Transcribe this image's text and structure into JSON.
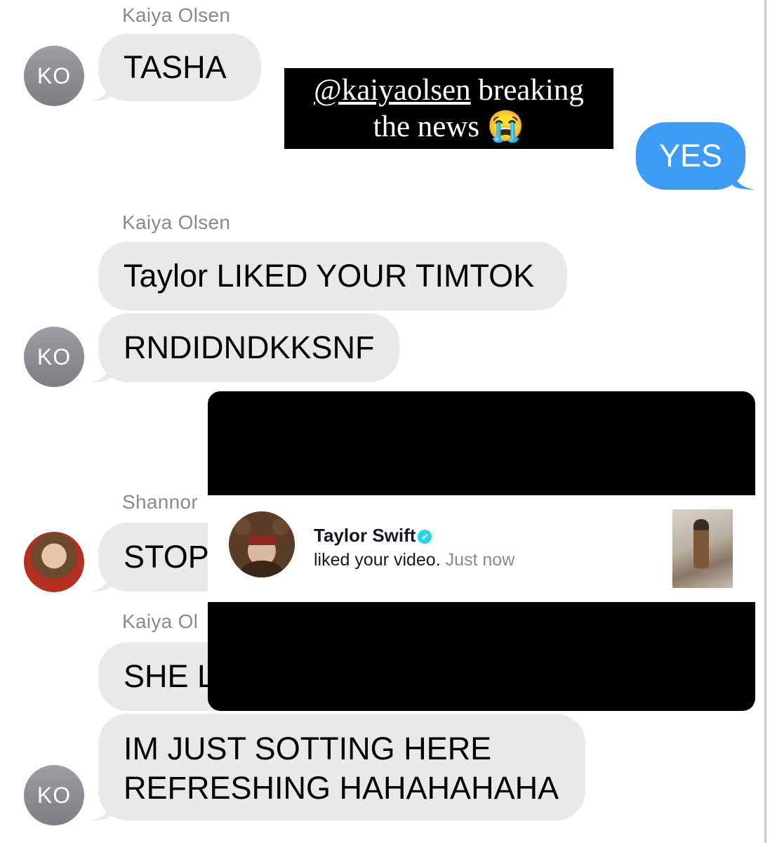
{
  "conversation": {
    "caption": {
      "mention": "@kaiyaolsen",
      "text_line1_rest": " breaking",
      "text_line2": "the news",
      "emoji": "😭"
    },
    "messages": [
      {
        "sender": "Kaiya Olsen",
        "text": "TASHA",
        "avatar_initials": "KO"
      },
      {
        "sender": "me",
        "text": "YES"
      },
      {
        "sender": "Kaiya Olsen",
        "text": "Taylor LIKED YOUR TIMTOK"
      },
      {
        "sender": "Kaiya Olsen",
        "text": "RNDIDNDKKSNF",
        "avatar_initials": "KO"
      },
      {
        "sender": "Shannor",
        "text": "STOP"
      },
      {
        "sender": "Kaiya Ol",
        "text": "SHE L"
      },
      {
        "sender": "Kaiya Olsen",
        "text_line1": "IM JUST SOTTING HERE",
        "text_line2": "REFRESHING HAHAHAHAHA",
        "avatar_initials": "KO"
      }
    ]
  },
  "notification": {
    "name": "Taylor Swift",
    "verified_icon": "✔",
    "action": "liked your video.",
    "time": "Just now"
  },
  "colors": {
    "incoming_bubble": "#e9e9eb",
    "outgoing_bubble": "#3d9bf6",
    "sender_label": "#8a8a8e",
    "avatar": "#8e8e93"
  }
}
